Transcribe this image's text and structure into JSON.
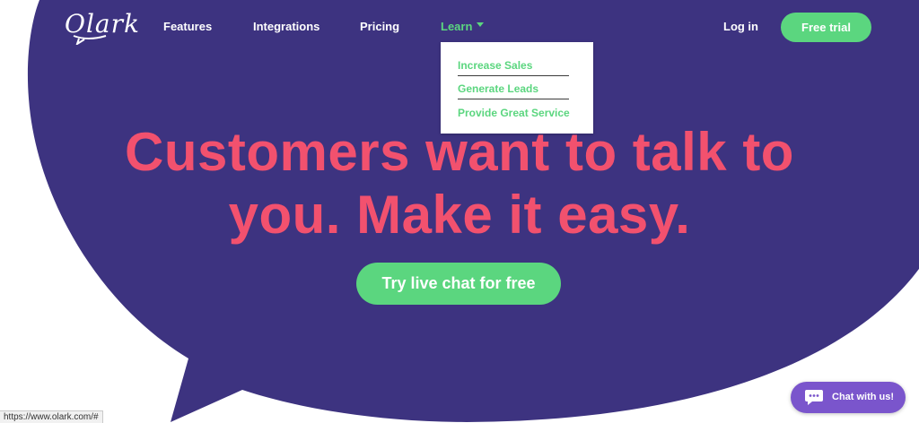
{
  "brand": {
    "logo": "Olark"
  },
  "nav": {
    "features": "Features",
    "integrations": "Integrations",
    "pricing": "Pricing",
    "learn": "Learn",
    "login": "Log in",
    "trial": "Free trial"
  },
  "learn_menu": {
    "items": [
      "Increase Sales",
      "Generate Leads",
      "Provide Great Service"
    ]
  },
  "hero": {
    "line1": "Customers want to talk to",
    "line2": "you. Make it easy.",
    "cta": "Try live chat for free"
  },
  "chat_widget": {
    "label": "Chat with us!"
  },
  "status_bar": {
    "url": "https://www.olark.com/#"
  },
  "colors": {
    "bubble": "#3d3380",
    "accent_green": "#5bd67f",
    "headline_pink": "#f2516e",
    "chat_purple": "#7a55cc"
  },
  "icons": [
    "chevron-down-icon",
    "chat-bubble-icon",
    "logo-speech-tail"
  ]
}
